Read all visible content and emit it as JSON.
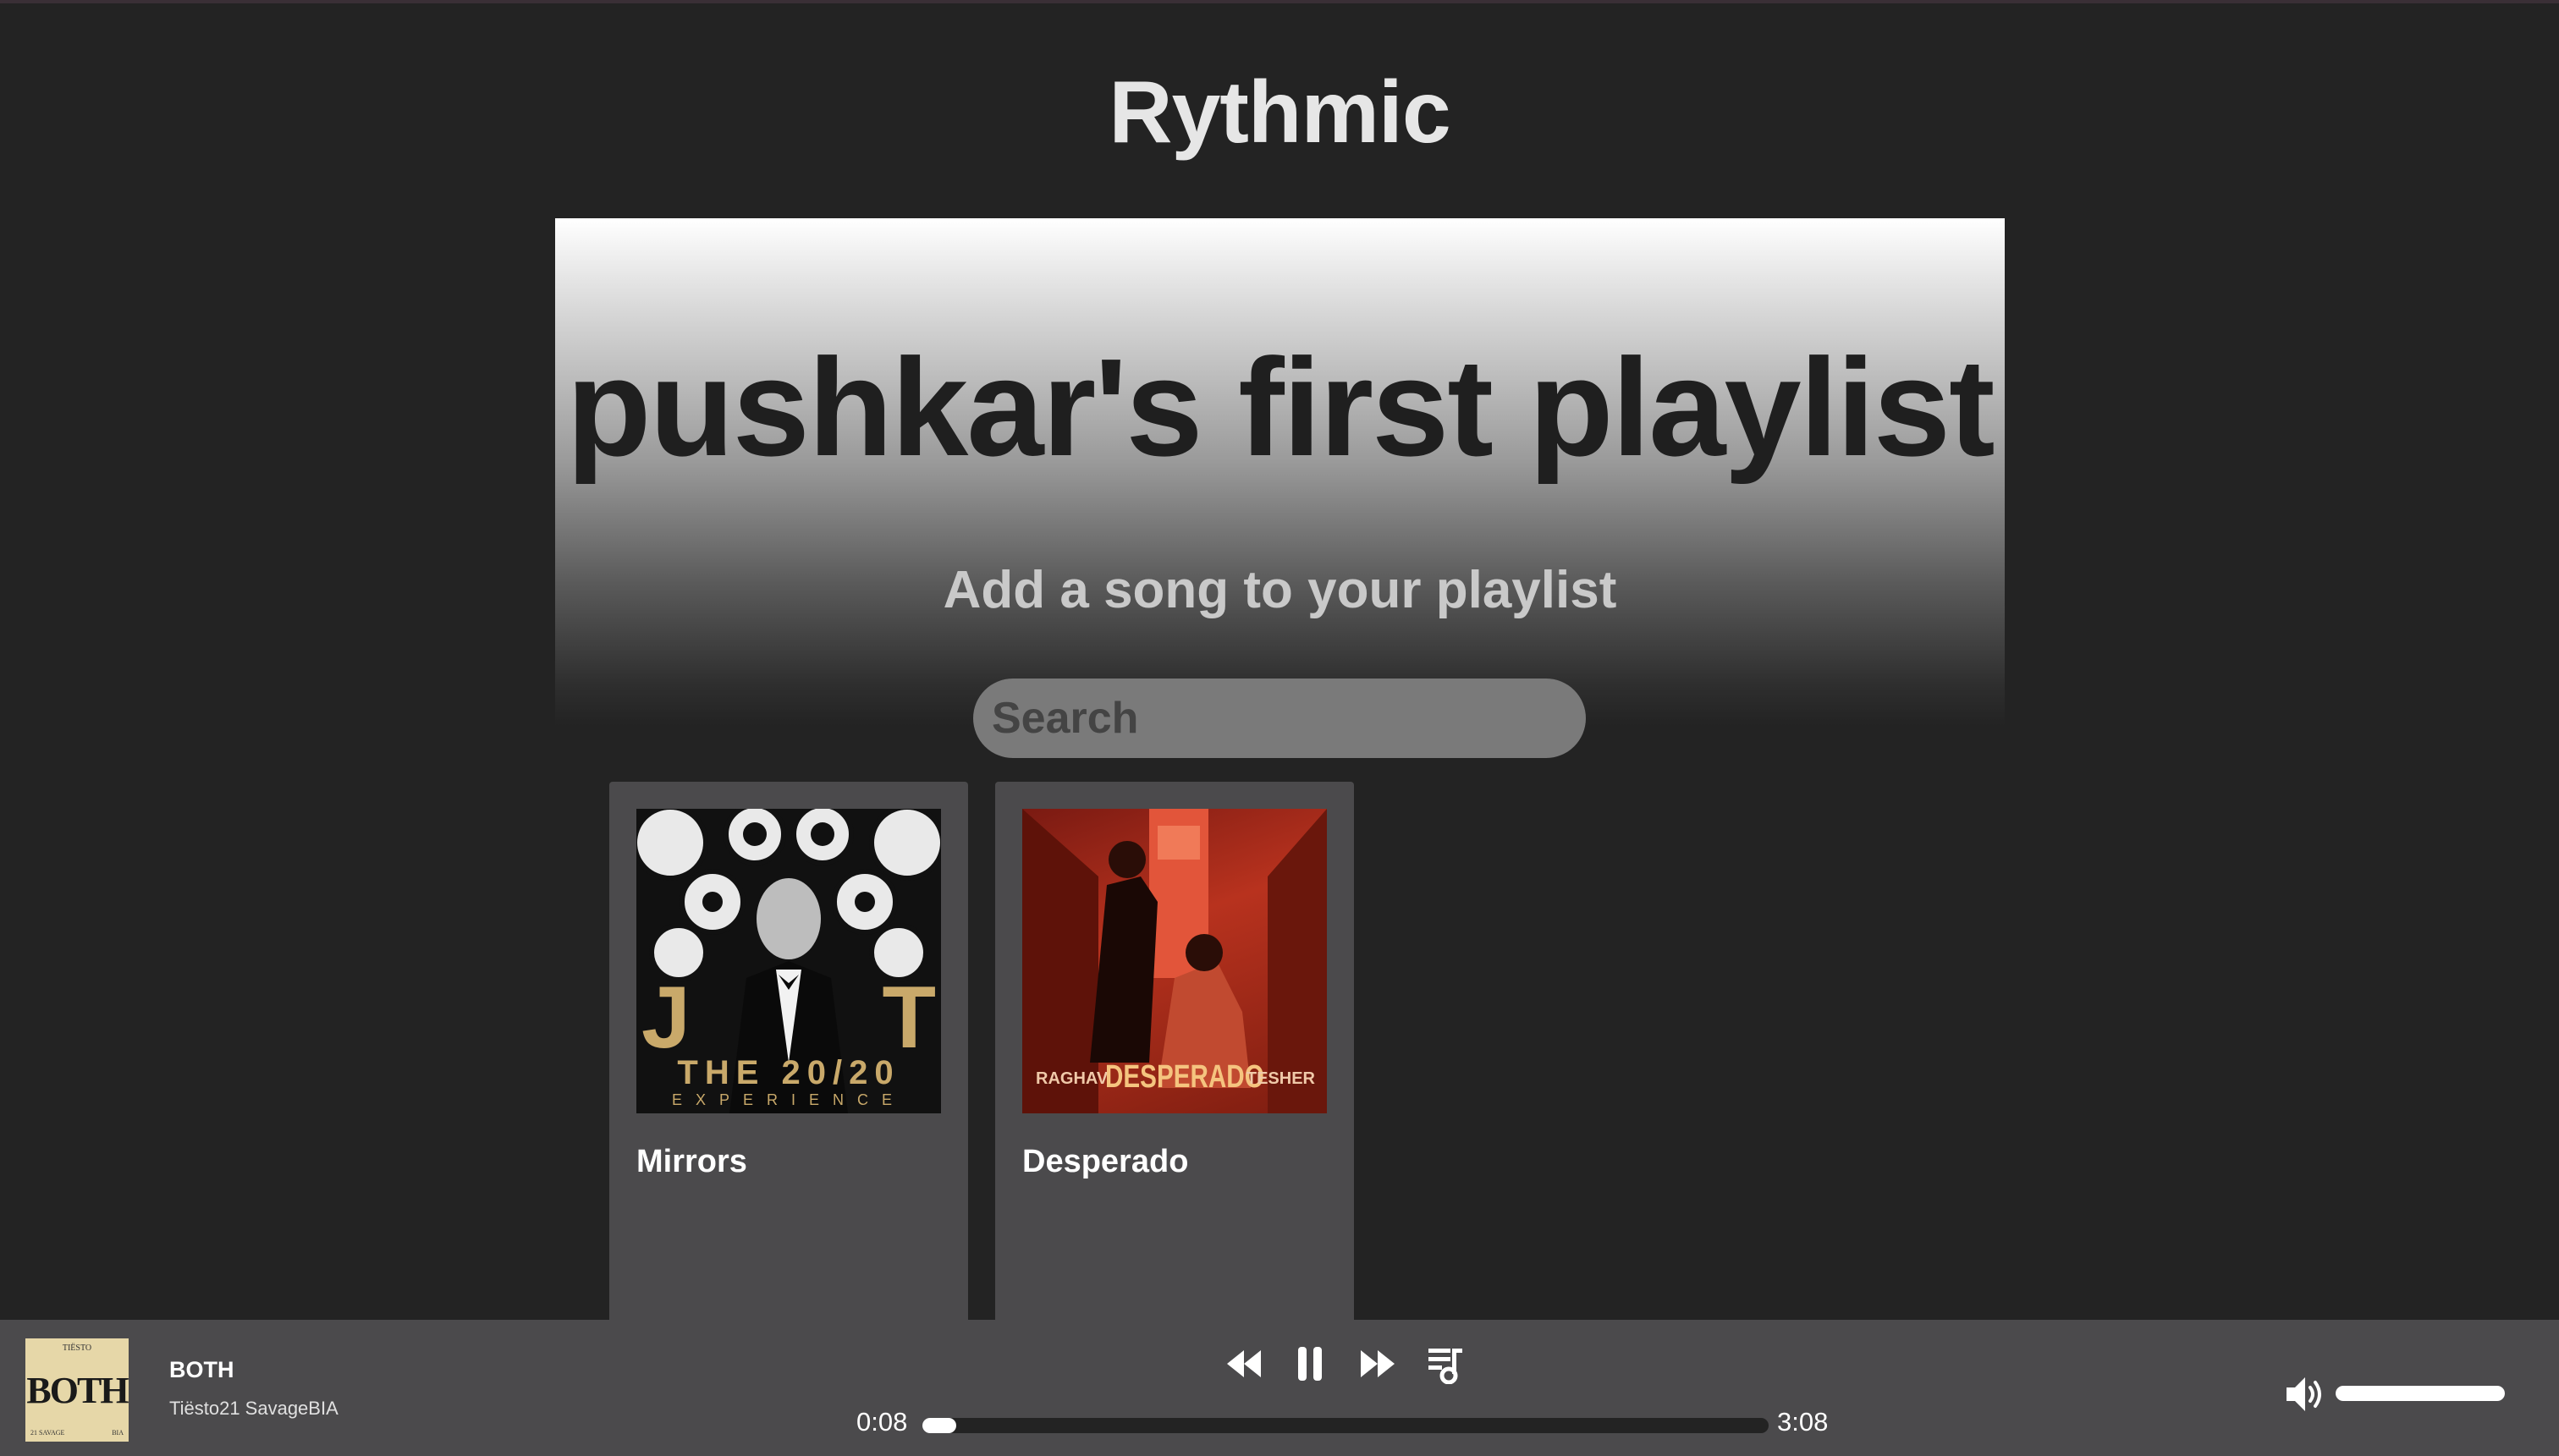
{
  "app": {
    "title": "Rythmic"
  },
  "playlist": {
    "title": "pushkar's first playlist",
    "add_song_label": "Add a song to your playlist",
    "search": {
      "placeholder": "Search",
      "value": ""
    },
    "songs": [
      {
        "title": "Mirrors",
        "art": {
          "top_text": "J",
          "top_text_right": "T",
          "line1": "THE 20/20",
          "line2": "EXPERIENCE"
        }
      },
      {
        "title": "Desperado",
        "art": {
          "left_text": "RAGHAV",
          "center_text": "DESPERADO",
          "right_text": "TESHER"
        }
      }
    ]
  },
  "player": {
    "track_title": "BOTH",
    "artists": "Tiësto21 SavageBIA",
    "art": {
      "top": "TIËSTO",
      "main": "BOTH",
      "bottom_left": "21 SAVAGE",
      "bottom_right": "BIA"
    },
    "elapsed": "0:08",
    "duration": "3:08",
    "progress_fraction": 0.04,
    "volume_fraction": 1.0,
    "icons": {
      "previous": "rewind-icon",
      "pause": "pause-icon",
      "next": "fast-forward-icon",
      "queue": "queue-music-icon",
      "volume": "volume-icon"
    }
  },
  "colors": {
    "background": "#232323",
    "player_bar": "#4b4a4c",
    "card": "#4b4a4c",
    "search_bg": "#7a7a7a"
  }
}
